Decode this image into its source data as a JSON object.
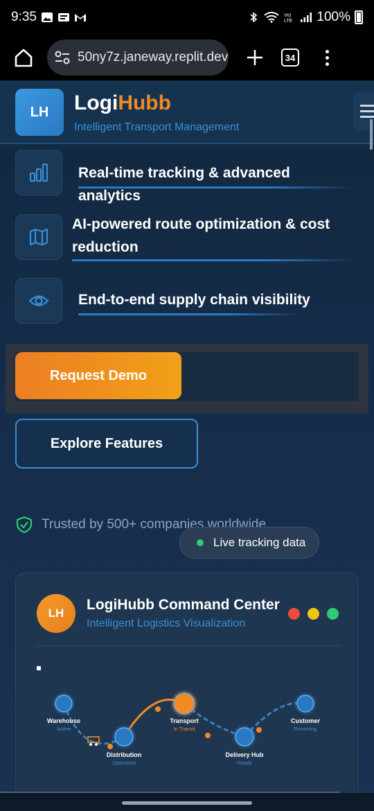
{
  "status_bar": {
    "time": "9:35",
    "battery": "100%"
  },
  "browser": {
    "url": "50ny7z.janeway.replit.dev",
    "tab_count": "34"
  },
  "header": {
    "logo_initials": "LH",
    "brand_part1": "Logi",
    "brand_part2": "Hubb",
    "tagline": "Intelligent Transport Management"
  },
  "features": [
    {
      "icon": "bar-chart-icon",
      "text": "Real-time tracking & advanced analytics"
    },
    {
      "icon": "map-icon",
      "line1": "AI-powered route optimization & cost",
      "line2": "reduction"
    },
    {
      "icon": "eye-icon",
      "text": "End-to-end supply chain visibility"
    }
  ],
  "cta": {
    "primary": "Request Demo",
    "secondary": "Explore Features"
  },
  "trusted": "Trusted by 500+ companies worldwide",
  "live_badge": "Live tracking data",
  "command_center": {
    "logo_initials": "LH",
    "title": "LogiHubb Command Center",
    "subtitle": "Intelligent Logistics Visualization",
    "window_dots": [
      "#e74c3c",
      "#f1c40f",
      "#2ecc71"
    ],
    "nodes": [
      {
        "name": "Warehouse",
        "status": "Active"
      },
      {
        "name": "Distribution",
        "status": "Optimized"
      },
      {
        "name": "Transport",
        "status": "In Transit"
      },
      {
        "name": "Delivery Hub",
        "status": "Ready"
      },
      {
        "name": "Customer",
        "status": "Receiving"
      }
    ]
  },
  "colors": {
    "accent_orange": "#f08a24",
    "accent_blue": "#3a8fd6",
    "bg": "#122840"
  }
}
